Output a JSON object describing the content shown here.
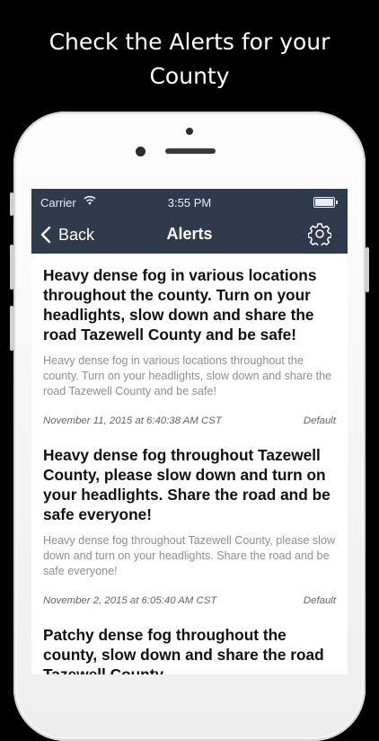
{
  "headline": {
    "line1": "Check the Alerts for your",
    "line2": "County"
  },
  "status_bar": {
    "carrier": "Carrier",
    "time": "3:55 PM"
  },
  "nav": {
    "back_label": "Back",
    "title": "Alerts"
  },
  "colors": {
    "nav_bg": "#2f3a4c",
    "page_bg": "#000000",
    "body_text": "#8f8f8f"
  },
  "alerts": [
    {
      "title": "Heavy dense fog in various locations throughout the county. Turn on your headlights, slow down and share the road Tazewell County and be safe!",
      "body": "Heavy dense fog in various locations throughout the county. Turn on your headlights, slow down and share the road Tazewell County and be safe!",
      "date": "November 11, 2015 at 6:40:38 AM CST",
      "category": "Default"
    },
    {
      "title": "Heavy dense fog throughout Tazewell County, please slow down and turn on your headlights. Share the road and be safe everyone!",
      "body": "Heavy dense fog throughout Tazewell County, please slow down and turn on your headlights. Share the road and be safe everyone!",
      "date": "November 2, 2015 at 6:05:40 AM CST",
      "category": "Default"
    },
    {
      "title": "Patchy dense fog throughout the county, slow down and share the road Tazewell County.",
      "body": "",
      "date": "",
      "category": ""
    }
  ]
}
